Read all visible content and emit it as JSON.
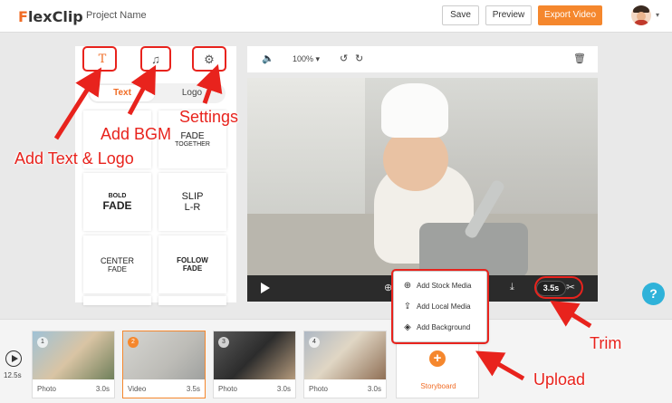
{
  "header": {
    "logo_f": "F",
    "logo_rest": "lexClip",
    "project_name": "Project Name",
    "save_label": "Save",
    "preview_label": "Preview",
    "export_label": "Export Video",
    "avatar_caret": "▾"
  },
  "left_panel": {
    "text_icon": "T",
    "music_icon": "♫",
    "settings_icon": "⚙",
    "tabs": {
      "text": "Text",
      "logo": "Logo"
    },
    "tiles": [
      {
        "l1": "FADE",
        "l2": "TOGETHER"
      },
      {
        "l1": "BOLD",
        "l2": "FADE"
      },
      {
        "l1": "SLIP",
        "l2": "L-R"
      },
      {
        "l1": "CENTER",
        "l2": "FADE"
      },
      {
        "l1": "FOLLOW",
        "l2": "FADE"
      }
    ]
  },
  "preview": {
    "volume_icon": "🔈",
    "zoom": "100% ▾",
    "undo_icon": "↺",
    "redo_icon": "↻",
    "trash_icon": "🗑",
    "globe_icon": "⊕",
    "split_icon": "⤓",
    "time": "3.5s",
    "scissors_icon": "✂"
  },
  "popup": {
    "items": [
      {
        "icon": "⊕",
        "label": "Add Stock Media"
      },
      {
        "icon": "⇪",
        "label": "Add Local Media"
      },
      {
        "icon": "◈",
        "label": "Add Background"
      }
    ]
  },
  "help": {
    "label": "?"
  },
  "timeline": {
    "total_duration": "12.5s",
    "clips": [
      {
        "num": "1",
        "type": "Photo",
        "dur": "3.0s"
      },
      {
        "num": "2",
        "type": "Video",
        "dur": "3.5s"
      },
      {
        "num": "3",
        "type": "Photo",
        "dur": "3.0s"
      },
      {
        "num": "4",
        "type": "Photo",
        "dur": "3.0s"
      }
    ],
    "storyboard_plus": "+",
    "storyboard_label": "Storyboard"
  },
  "annotations": {
    "settings": "Settings",
    "bgm": "Add BGM",
    "text_logo": "Add Text & Logo",
    "trim": "Trim",
    "upload": "Upload"
  },
  "colors": {
    "accent": "#f5872d",
    "annotation": "#e8231d",
    "help": "#2fb2d9"
  }
}
